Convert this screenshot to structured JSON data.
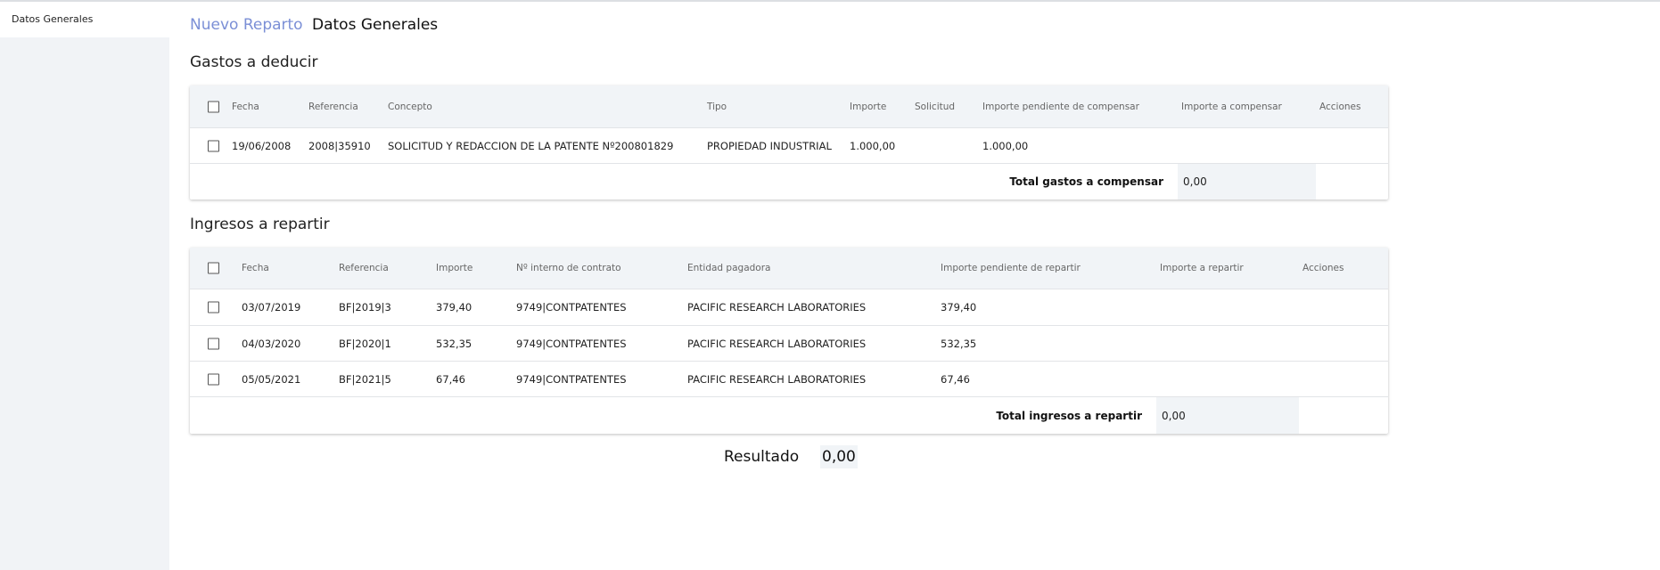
{
  "sidebar": {
    "items": [
      {
        "label": "Datos Generales"
      }
    ]
  },
  "header": {
    "breadcrumb": "Nuevo Reparto",
    "title": "Datos Generales"
  },
  "gastos": {
    "title": "Gastos a deducir",
    "columns": [
      "Fecha",
      "Referencia",
      "Concepto",
      "Tipo",
      "Importe",
      "Solicitud",
      "Importe pendiente de compensar",
      "Importe a compensar",
      "Acciones"
    ],
    "rows": [
      {
        "fecha": "19/06/2008",
        "referencia": "2008|35910",
        "concepto": "SOLICITUD Y REDACCION DE LA PATENTE Nº200801829",
        "tipo": "PROPIEDAD INDUSTRIAL",
        "importe": "1.000,00",
        "solicitud": "",
        "pendiente": "1.000,00",
        "a_compensar": ""
      }
    ],
    "total_label": "Total gastos a compensar",
    "total_value": "0,00"
  },
  "ingresos": {
    "title": "Ingresos a repartir",
    "columns": [
      "Fecha",
      "Referencia",
      "Importe",
      "Nº interno de contrato",
      "Entidad pagadora",
      "Importe pendiente de repartir",
      "Importe a repartir",
      "Acciones"
    ],
    "rows": [
      {
        "fecha": "03/07/2019",
        "referencia": "BF|2019|3",
        "importe": "379,40",
        "contrato": "9749|CONTPATENTES",
        "entidad": "PACIFIC RESEARCH LABORATORIES",
        "pendiente": "379,40"
      },
      {
        "fecha": "04/03/2020",
        "referencia": "BF|2020|1",
        "importe": "532,35",
        "contrato": "9749|CONTPATENTES",
        "entidad": "PACIFIC RESEARCH LABORATORIES",
        "pendiente": "532,35"
      },
      {
        "fecha": "05/05/2021",
        "referencia": "BF|2021|5",
        "importe": "67,46",
        "contrato": "9749|CONTPATENTES",
        "entidad": "PACIFIC RESEARCH LABORATORIES",
        "pendiente": "67,46"
      }
    ],
    "total_label": "Total ingresos a repartir",
    "total_value": "0,00"
  },
  "resultado": {
    "label": "Resultado",
    "value": "0,00"
  }
}
